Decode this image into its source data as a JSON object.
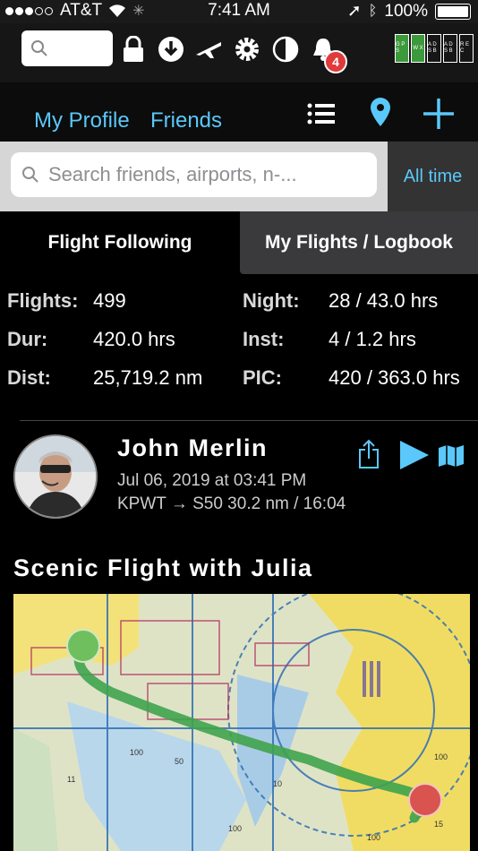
{
  "status_bar": {
    "carrier": "AT&T",
    "time": "7:41 AM",
    "battery": "100%"
  },
  "toolbar": {
    "notification_count": "4",
    "gps_panel": [
      {
        "label": "G P S",
        "on": true
      },
      {
        "label": "W X",
        "on": true
      },
      {
        "label": "A D S B",
        "on": false
      },
      {
        "label": "A D S B",
        "on": false
      },
      {
        "label": "R E C",
        "on": false
      }
    ]
  },
  "nav": {
    "my_profile": "My Profile",
    "friends": "Friends"
  },
  "search": {
    "placeholder": "Search friends, airports, n-...",
    "filter": "All time"
  },
  "tabs": {
    "following": "Flight Following",
    "logbook": "My Flights / Logbook"
  },
  "stats": {
    "flights_label": "Flights:",
    "flights_value": "499",
    "dur_label": "Dur:",
    "dur_value": "420.0 hrs",
    "dist_label": "Dist:",
    "dist_value": "25,719.2 nm",
    "night_label": "Night:",
    "night_value": "28 / 43.0 hrs",
    "inst_label": "Inst:",
    "inst_value": "4 / 1.2 hrs",
    "pic_label": "PIC:",
    "pic_value": "420 / 363.0 hrs"
  },
  "flight": {
    "pilot": "John Merlin",
    "date": "Jul 06, 2019 at 03:41 PM",
    "route": "KPWT → S50 30.2 nm / 16:04",
    "title": "Scenic Flight with Julia"
  },
  "colors": {
    "accent": "#5ac8fa",
    "badge": "#e03a3a",
    "route_line": "#3fa34d"
  }
}
